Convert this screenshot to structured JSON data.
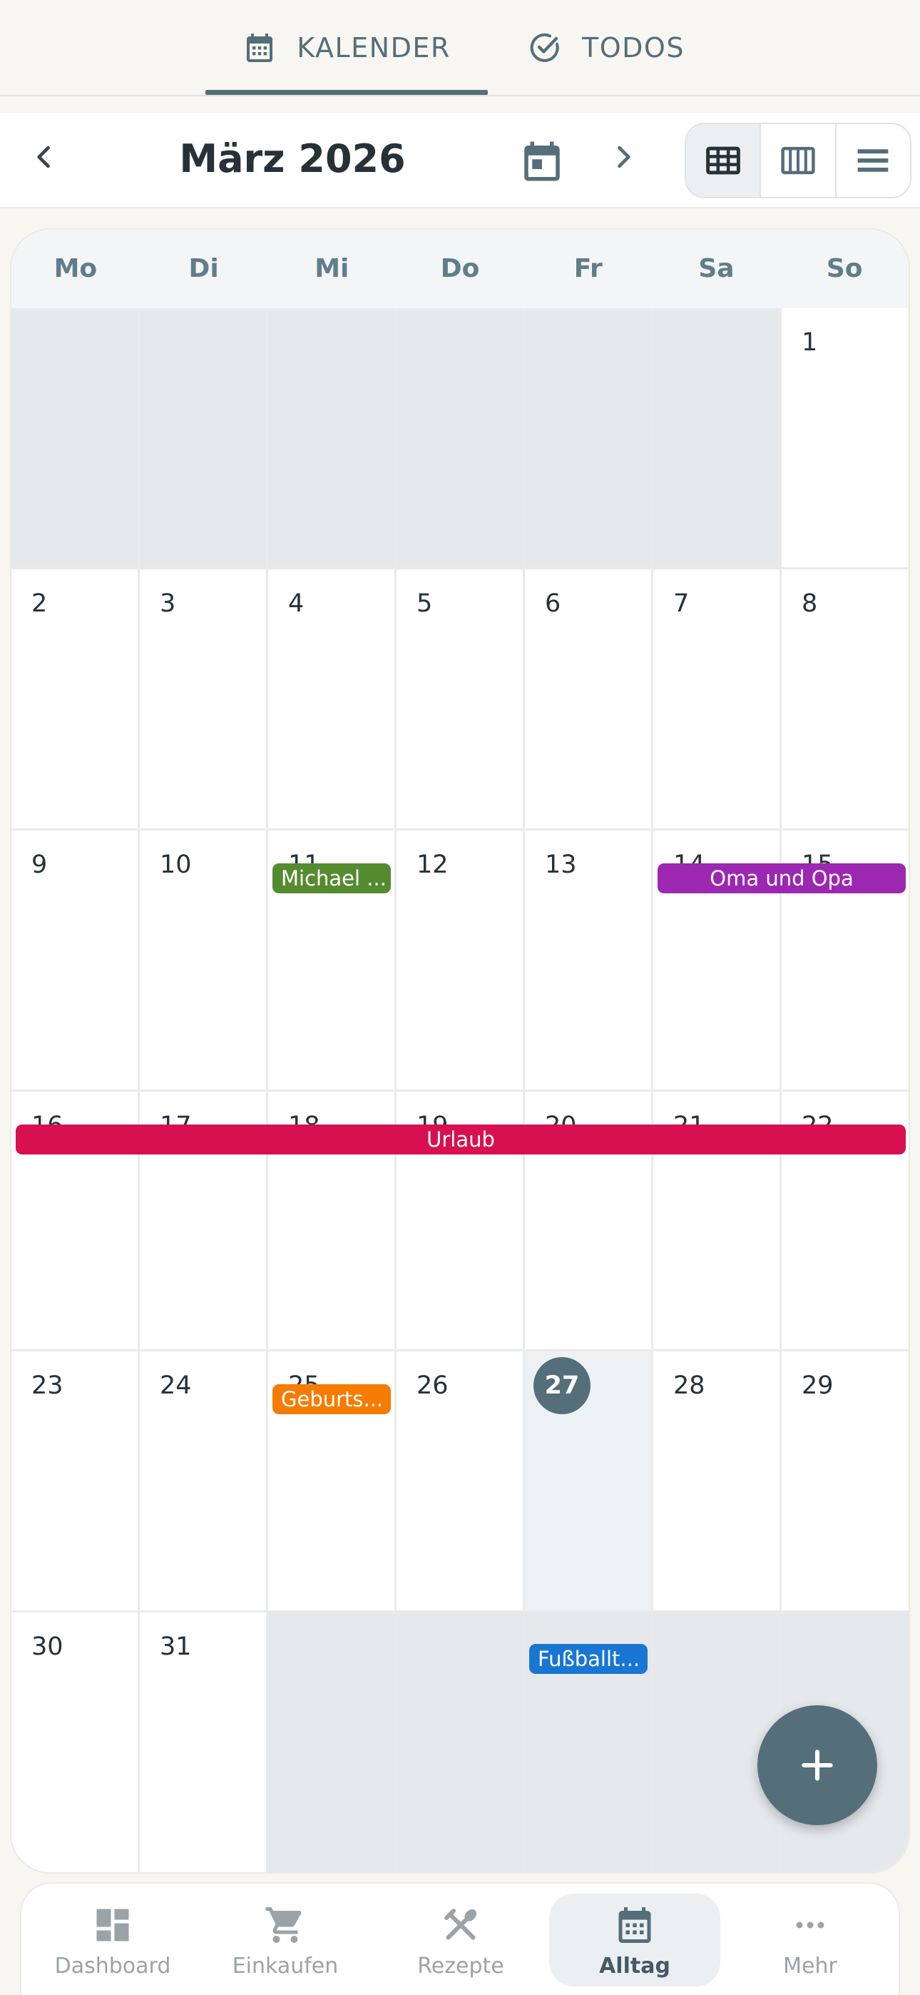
{
  "tabs": [
    {
      "label": "KALENDER",
      "icon": "calendar-icon",
      "active": true
    },
    {
      "label": "TODOS",
      "icon": "check-circle-icon",
      "active": false
    }
  ],
  "toolbar": {
    "month_title": "März 2026",
    "prev_icon": "chevron-left-icon",
    "next_icon": "chevron-right-icon",
    "today_icon": "calendar-today-icon",
    "views": [
      "month-grid-icon",
      "week-columns-icon",
      "list-rows-icon"
    ],
    "active_view": "month-grid-icon"
  },
  "weekdays": [
    "Mo",
    "Di",
    "Mi",
    "Do",
    "Fr",
    "Sa",
    "So"
  ],
  "days": {
    "d1": "1",
    "d2": "2",
    "d3": "3",
    "d4": "4",
    "d5": "5",
    "d6": "6",
    "d7": "7",
    "d8": "8",
    "d9": "9",
    "d10": "10",
    "d11": "11",
    "d12": "12",
    "d13": "13",
    "d14": "14",
    "d15": "15",
    "d16": "16",
    "d17": "17",
    "d18": "18",
    "d19": "19",
    "d20": "20",
    "d21": "21",
    "d22": "22",
    "d23": "23",
    "d24": "24",
    "d25": "25",
    "d26": "26",
    "d27": "27",
    "d28": "28",
    "d29": "29",
    "d30": "30",
    "d31": "31"
  },
  "today": "27",
  "events": [
    {
      "title": "Michael ...",
      "color": "#558b2f"
    },
    {
      "title": "Oma und Opa",
      "color": "#9c27b0"
    },
    {
      "title": "Urlaub",
      "color": "#d81050"
    },
    {
      "title": "Geburts...",
      "color": "#f57c00"
    },
    {
      "title": "Fußballt...",
      "color": "#1976d2"
    }
  ],
  "fab": {
    "icon": "plus-icon"
  },
  "bottom_nav": [
    {
      "label": "Dashboard",
      "icon": "dashboard-icon",
      "active": false
    },
    {
      "label": "Einkaufen",
      "icon": "shopping-cart-icon",
      "active": false
    },
    {
      "label": "Rezepte",
      "icon": "utensils-icon",
      "active": false
    },
    {
      "label": "Alltag",
      "icon": "calendar-icon",
      "active": true
    },
    {
      "label": "Mehr",
      "icon": "more-dots-icon",
      "active": false
    }
  ],
  "colors": {
    "accent": "#546e7a",
    "other_month": "#e6e9ec",
    "background": "#f8f6f1"
  }
}
